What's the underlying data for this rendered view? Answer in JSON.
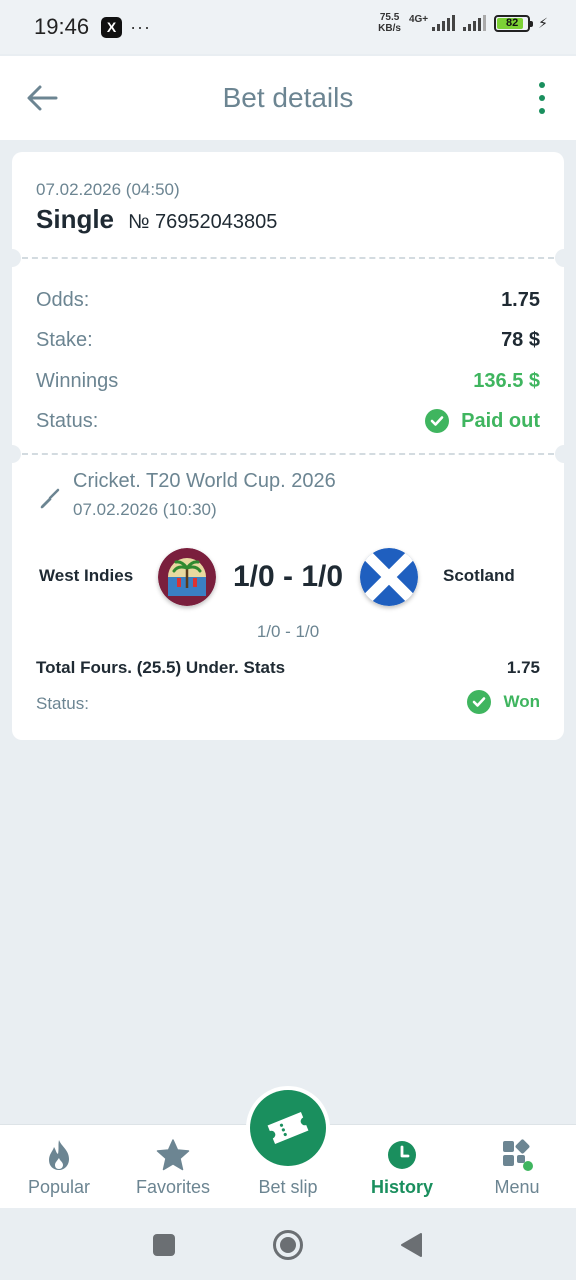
{
  "status_bar": {
    "time": "19:46",
    "x_app": "X",
    "more_dots": "···",
    "net_speed_value": "75.5",
    "net_speed_unit": "KB/s",
    "network_type": "4G+",
    "battery_level": "82"
  },
  "header": {
    "title": "Bet details"
  },
  "bet": {
    "date": "07.02.2026 (04:50)",
    "type": "Single",
    "number": "№ 76952043805",
    "odds_label": "Odds:",
    "odds_value": "1.75",
    "stake_label": "Stake:",
    "stake_value": "78 $",
    "winnings_label": "Winnings",
    "winnings_value": "136.5 $",
    "status_label": "Status:",
    "status_value": "Paid out"
  },
  "event": {
    "title": "Cricket. T20 World Cup. 2026",
    "date": "07.02.2026 (10:30)",
    "team1": "West Indies",
    "team2": "Scotland",
    "score": "1/0 - 1/0",
    "score_sub": "1/0 - 1/0",
    "market": "Total Fours. (25.5) Under. Stats",
    "market_odds": "1.75",
    "status_label": "Status:",
    "status_value": "Won"
  },
  "bottom_nav": {
    "popular": "Popular",
    "favorites": "Favorites",
    "bet_slip": "Bet slip",
    "history": "History",
    "menu": "Menu",
    "active": "History"
  },
  "colors": {
    "accent_green": "#1a8f5e",
    "success_green": "#3fb55f",
    "muted_text": "#6c8592"
  }
}
